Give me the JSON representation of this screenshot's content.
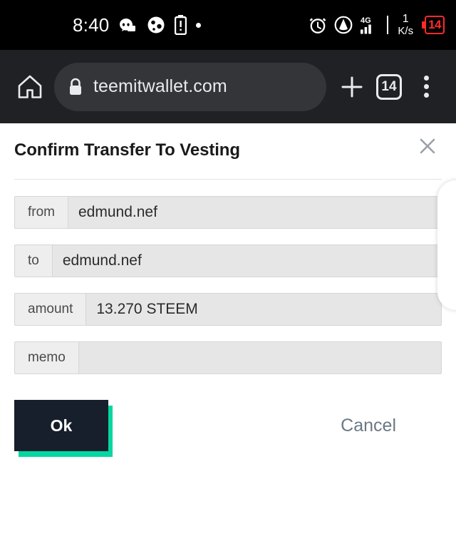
{
  "statusbar": {
    "time": "8:40",
    "left_icons": [
      "discord-icon",
      "globe-icon",
      "battery-alert-icon",
      "dot-indicator"
    ],
    "right_icons": [
      "alarm-clock-icon",
      "location-radar-icon",
      "signal-4g-icon"
    ],
    "network_label": "4G",
    "data_rate_value": "1",
    "data_rate_unit": "K/s",
    "battery_level": "14",
    "battery_color": "#ff2a2a",
    "background": "#000000"
  },
  "toolbar": {
    "home_icon": "home-icon",
    "lock_icon": "lock-icon",
    "url": "teemitwallet.com",
    "new_tab_label": "+",
    "tab_count": "14",
    "menu_icon": "kebab-menu-icon",
    "background": "#202124"
  },
  "dialog": {
    "title": "Confirm Transfer To Vesting",
    "close_label": "×",
    "fields": [
      {
        "label": "from",
        "value": "edmund.nef"
      },
      {
        "label": "to",
        "value": "edmund.nef"
      },
      {
        "label": "amount",
        "value": "13.270 STEEM"
      },
      {
        "label": "memo",
        "value": ""
      }
    ],
    "ok_label": "Ok",
    "cancel_label": "Cancel",
    "ok_color": "#161f2b",
    "ok_shadow_color": "#06d6a0",
    "cancel_color": "#6b7886"
  }
}
